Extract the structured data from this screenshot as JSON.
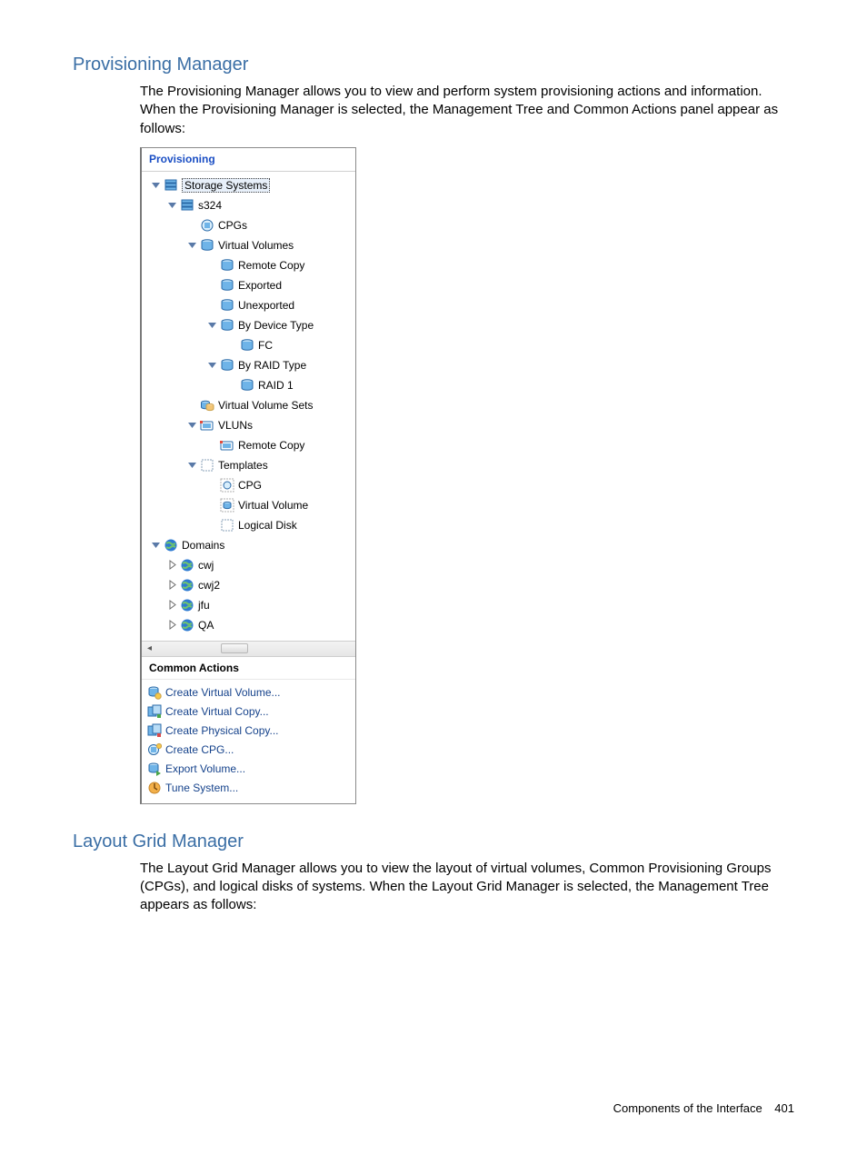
{
  "sections": {
    "provisioning": {
      "heading": "Provisioning Manager",
      "paragraph": "The Provisioning Manager allows you to view and perform system provisioning actions and information. When the Provisioning Manager is selected, the Management Tree and Common Actions panel appear as follows:"
    },
    "layout": {
      "heading": "Layout Grid Manager",
      "paragraph": "The Layout Grid Manager allows you to view the layout of virtual volumes, Common Provisioning Groups (CPGs), and logical disks of systems. When the Layout Grid Manager is selected, the Management Tree appears as follows:"
    }
  },
  "panel": {
    "title": "Provisioning",
    "tree": [
      {
        "label": "Storage Systems",
        "depth": 0,
        "expander": "down",
        "icon": "stack",
        "selected": true
      },
      {
        "label": "s324",
        "depth": 1,
        "expander": "down",
        "icon": "stack"
      },
      {
        "label": "CPGs",
        "depth": 2,
        "expander": "none",
        "icon": "cpg"
      },
      {
        "label": "Virtual Volumes",
        "depth": 2,
        "expander": "down",
        "icon": "vol"
      },
      {
        "label": "Remote Copy",
        "depth": 3,
        "expander": "none",
        "icon": "vol"
      },
      {
        "label": "Exported",
        "depth": 3,
        "expander": "none",
        "icon": "vol"
      },
      {
        "label": "Unexported",
        "depth": 3,
        "expander": "none",
        "icon": "vol"
      },
      {
        "label": "By Device Type",
        "depth": 3,
        "expander": "down",
        "icon": "vol"
      },
      {
        "label": "FC",
        "depth": 4,
        "expander": "none",
        "icon": "vol"
      },
      {
        "label": "By RAID Type",
        "depth": 3,
        "expander": "down",
        "icon": "vol"
      },
      {
        "label": "RAID 1",
        "depth": 4,
        "expander": "none",
        "icon": "vol"
      },
      {
        "label": "Virtual Volume Sets",
        "depth": 2,
        "expander": "none",
        "icon": "volset"
      },
      {
        "label": "VLUNs",
        "depth": 2,
        "expander": "down",
        "icon": "vlun"
      },
      {
        "label": "Remote Copy",
        "depth": 3,
        "expander": "none",
        "icon": "vlun"
      },
      {
        "label": "Templates",
        "depth": 2,
        "expander": "down",
        "icon": "template"
      },
      {
        "label": "CPG",
        "depth": 3,
        "expander": "none",
        "icon": "cpg-t"
      },
      {
        "label": "Virtual Volume",
        "depth": 3,
        "expander": "none",
        "icon": "vv-t"
      },
      {
        "label": "Logical Disk",
        "depth": 3,
        "expander": "none",
        "icon": "template"
      },
      {
        "label": "Domains",
        "depth": 0,
        "expander": "down",
        "icon": "globe"
      },
      {
        "label": "cwj",
        "depth": 1,
        "expander": "right",
        "icon": "globe"
      },
      {
        "label": "cwj2",
        "depth": 1,
        "expander": "right",
        "icon": "globe"
      },
      {
        "label": "jfu",
        "depth": 1,
        "expander": "right",
        "icon": "globe"
      },
      {
        "label": "QA",
        "depth": 1,
        "expander": "right",
        "icon": "globe"
      }
    ],
    "common_actions_header": "Common Actions",
    "actions": [
      {
        "label": "Create Virtual Volume...",
        "icon": "vol-new"
      },
      {
        "label": "Create Virtual Copy...",
        "icon": "copy-v"
      },
      {
        "label": "Create Physical Copy...",
        "icon": "copy-p"
      },
      {
        "label": "Create CPG...",
        "icon": "cpg-new"
      },
      {
        "label": "Export Volume...",
        "icon": "vol-exp"
      },
      {
        "label": "Tune System...",
        "icon": "tune"
      }
    ]
  },
  "footer": {
    "text": "Components of the Interface",
    "page": "401"
  }
}
